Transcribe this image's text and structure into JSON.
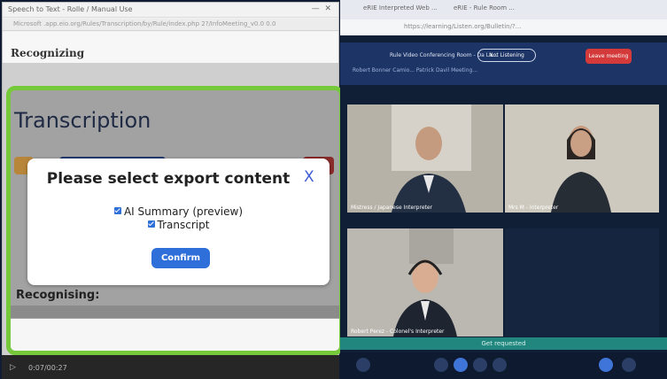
{
  "left_window": {
    "title": "Speech to Text - Rolle / Manual Use",
    "url": "Microsoft .app.eio.org/Rules/Transcription/by/Rule/index.php 2?/InfoMeeting_v0.0 0.0",
    "recognizing_header": "Recognizing",
    "transcription_title": "Transcription",
    "recognising_label": "Recognising:",
    "media_time": "0:07/00:27",
    "modal": {
      "title": "Please select export content",
      "close_label": "X",
      "options": [
        {
          "label": "AI Summary (preview)",
          "checked": true
        },
        {
          "label": "Transcript",
          "checked": true
        }
      ],
      "confirm_label": "Confirm"
    }
  },
  "right_window": {
    "tabs": [
      "eRIE Interpreted Web ...",
      "eRIE - Rule Room ..."
    ],
    "url": "https://learning/Listen.org/Bulletin/?...",
    "meeting_title": "Rule Video Conferencing Room - Da La...",
    "pill_label": "Not Listening",
    "leave_label": "Leave meeting",
    "subtitle": "Robert Bonner  Camio...   Patrick Davil  Meeting...",
    "tiles": [
      {
        "label": "Mistress / Japanese Interpreter"
      },
      {
        "label": "Mrs M - Interpreter"
      },
      {
        "label": "Robert Perez - Colonel's Interpreter"
      },
      {
        "label": ""
      }
    ],
    "relay_strip": "Get requested"
  }
}
